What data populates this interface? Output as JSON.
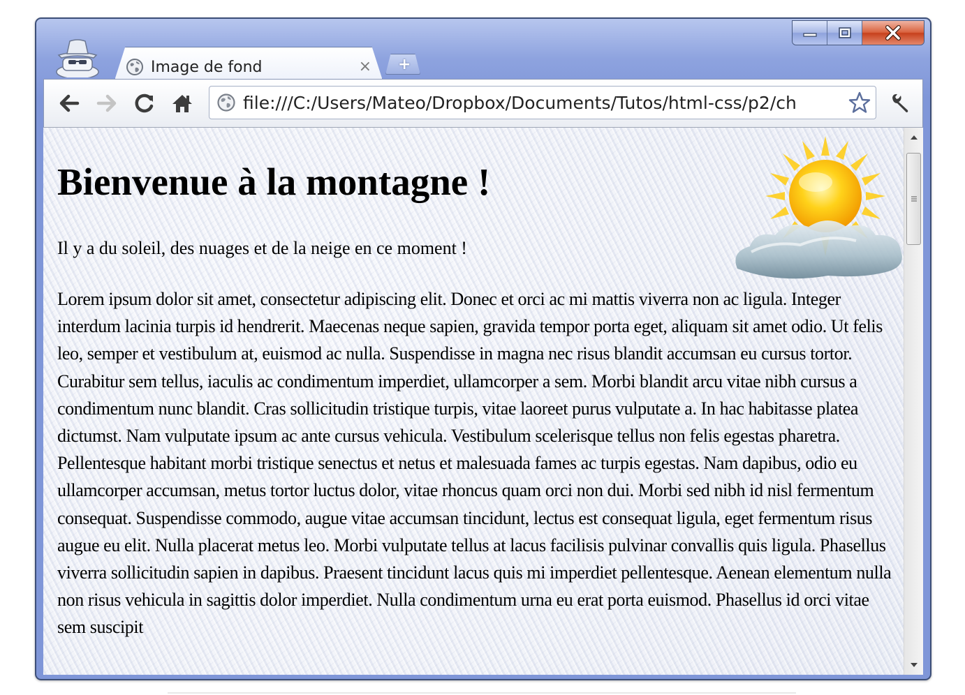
{
  "window": {
    "controls": {
      "minimize_icon": "minimize-icon",
      "maximize_icon": "maximize-icon",
      "close_icon": "close-icon"
    },
    "incognito_icon": "incognito-icon"
  },
  "tabs": [
    {
      "title": "Image de fond",
      "favicon": "globe-icon",
      "close_glyph": "×"
    }
  ],
  "new_tab_glyph": "+",
  "toolbar": {
    "back_icon": "back-arrow-icon",
    "forward_icon": "forward-arrow-icon",
    "reload_icon": "reload-icon",
    "home_icon": "home-icon",
    "url": "file:///C:/Users/Mateo/Dropbox/Documents/Tutos/html-css/p2/ch",
    "bookmark_icon": "star-icon",
    "wrench_icon": "wrench-icon"
  },
  "page": {
    "heading": "Bienvenue à la montagne !",
    "intro": "Il y a du soleil, des nuages et de la neige en ce moment !",
    "lorem": "Lorem ipsum dolor sit amet, consectetur adipiscing elit. Donec et orci ac mi mattis viverra non ac ligula. Integer interdum lacinia turpis id hendrerit. Maecenas neque sapien, gravida tempor porta eget, aliquam sit amet odio. Ut felis leo, semper et vestibulum at, euismod ac nulla. Suspendisse in magna nec risus blandit accumsan eu cursus tortor. Curabitur sem tellus, iaculis ac condimentum imperdiet, ullamcorper a sem. Morbi blandit arcu vitae nibh cursus a condimentum nunc blandit. Cras sollicitudin tristique turpis, vitae laoreet purus vulputate a. In hac habitasse platea dictumst. Nam vulputate ipsum ac ante cursus vehicula. Vestibulum scelerisque tellus non felis egestas pharetra. Pellentesque habitant morbi tristique senectus et netus et malesuada fames ac turpis egestas. Nam dapibus, odio eu ullamcorper accumsan, metus tortor luctus dolor, vitae rhoncus quam orci non dui. Morbi sed nibh id nisl fermentum consequat. Suspendisse commodo, augue vitae accumsan tincidunt, lectus est consequat ligula, eget fermentum risus augue eu elit. Nulla placerat metus leo. Morbi vulputate tellus at lacus facilisis pulvinar convallis quis ligula. Phasellus viverra sollicitudin sapien in dapibus. Praesent tincidunt lacus quis mi imperdiet pellentesque. Aenean elementum nulla non risus vehicula in sagittis dolor imperdiet. Nulla condimentum urna eu erat porta euismod. Phasellus id orci vitae sem suscipit",
    "sun_image": "sun-cloud-icon"
  },
  "colors": {
    "frame": "#7f96d8",
    "close_button": "#c7411d",
    "text": "#000000"
  }
}
